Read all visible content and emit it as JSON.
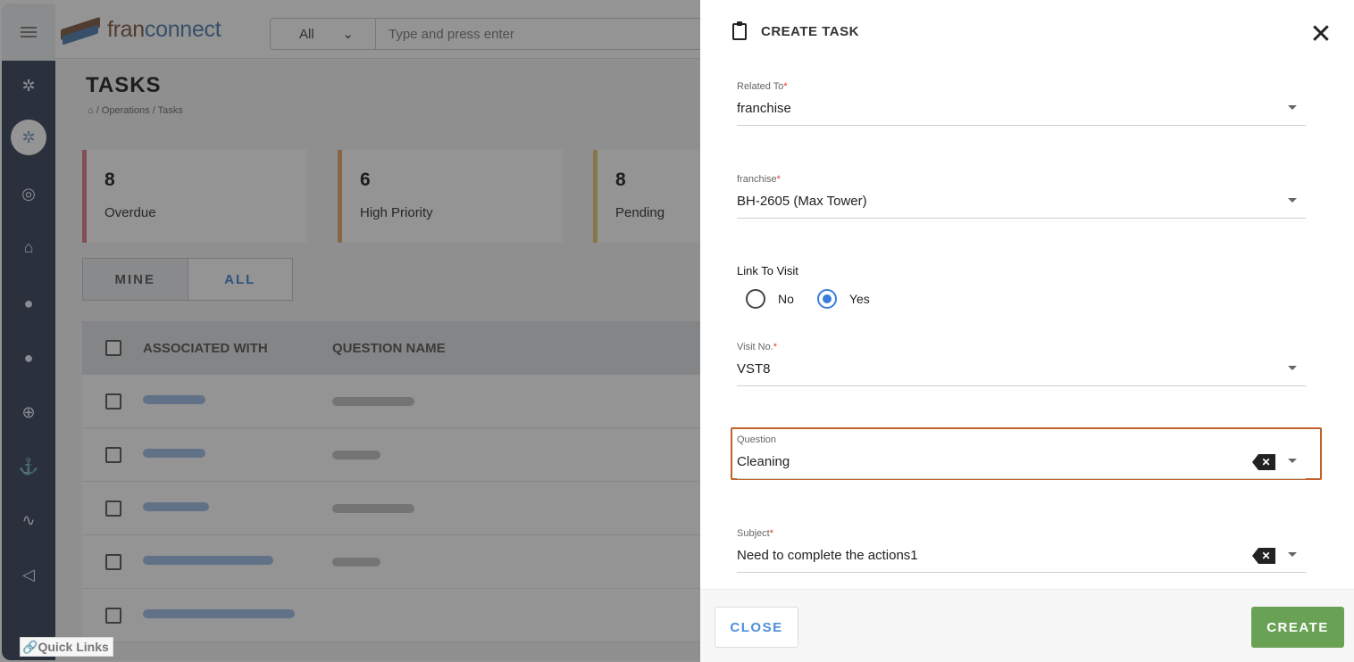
{
  "app": {
    "logo_text_a": "fran",
    "logo_text_b": "connect",
    "search_scope": "All",
    "search_placeholder": "Type and press enter",
    "quick_links": "Quick Links"
  },
  "page": {
    "title": "TASKS",
    "breadcrumb": "/ Operations / Tasks",
    "stats": [
      {
        "count": "8",
        "label": "Overdue",
        "color": "#e08a8a"
      },
      {
        "count": "6",
        "label": "High Priority",
        "color": "#e9b079"
      },
      {
        "count": "8",
        "label": "Pending",
        "color": "#e6cf7c"
      }
    ],
    "filter": {
      "mine": "MINE",
      "all": "ALL"
    },
    "table_headers": [
      "ASSOCIATED WITH",
      "QUESTION NAME"
    ]
  },
  "modal": {
    "title": "CREATE TASK",
    "fields": {
      "related_to": {
        "label": "Related To",
        "value": "franchise"
      },
      "franchise": {
        "label": "franchise",
        "value": "BH-2605 (Max Tower)"
      },
      "visit_no": {
        "label": "Visit No.",
        "value": "VST8"
      },
      "question": {
        "label": "Question",
        "value": "Cleaning"
      },
      "subject": {
        "label": "Subject",
        "value": "Need to complete the actions1"
      }
    },
    "link_to_visit": {
      "label": "Link To Visit",
      "options": [
        "No",
        "Yes"
      ],
      "selected": "Yes"
    },
    "close_label": "CLOSE",
    "create_label": "CREATE"
  }
}
